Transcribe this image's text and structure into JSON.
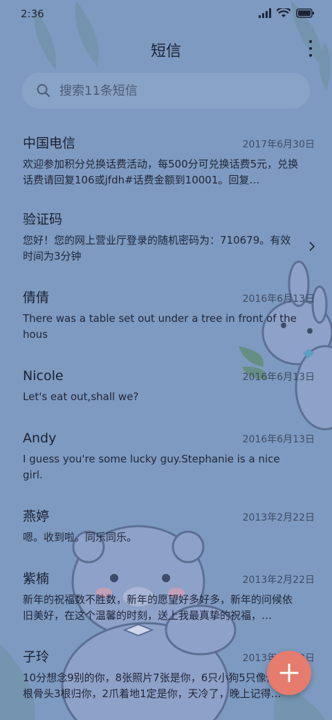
{
  "status": {
    "time": "2:36"
  },
  "header": {
    "title": "短信"
  },
  "search": {
    "placeholder": "搜索11条短信"
  },
  "messages": [
    {
      "sender": "中国电信",
      "date": "2017年6月30日",
      "snippet": "欢迎参加积分兑换话费活动，每500分可兑换话费5元，兑换话费请回复106或jfdh#话费金额到10001。回复…"
    },
    {
      "sender": "验证码",
      "date": "",
      "snippet": "您好！您的网上营业厅登录的随机密码为：710679。有效时间为3分钟"
    },
    {
      "sender": "倩倩",
      "date": "2016年6月13日",
      "snippet": "There was a table set out under a tree in front of the hous"
    },
    {
      "sender": "Nicole",
      "date": "2016年6月13日",
      "snippet": "Let's eat out,shall we?"
    },
    {
      "sender": "Andy",
      "date": "2016年6月13日",
      "snippet": "I guess you're some lucky guy.Stephanie is a nice girl."
    },
    {
      "sender": "燕婷",
      "date": "2013年2月22日",
      "snippet": "嗯。收到啦。同乐同乐。"
    },
    {
      "sender": "紫楠",
      "date": "2013年2月22日",
      "snippet": "新年的祝福数不胜数，新年的愿望好多好多，新年的问候依旧美好，在这个温馨的时刻，送上我最真挚的祝福，…"
    },
    {
      "sender": "子玲",
      "date": "2013年2月22日",
      "snippet": "10分想念9别的你，8张照片7张是你，6只小狗5只像你，4根骨头3根归你，2爪着地1定是你，天冷了，晚上记得…"
    }
  ],
  "icons": {
    "search": "search-icon",
    "more": "more-vertical-icon",
    "chevron": "chevron-right-icon",
    "fab": "plus-icon"
  },
  "colors": {
    "background": "#7e9ac0",
    "fab": "#e67c6d",
    "text": "#1b2133"
  }
}
